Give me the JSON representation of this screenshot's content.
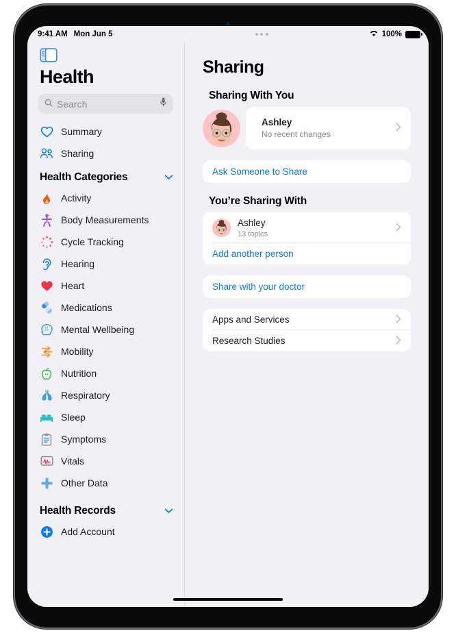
{
  "statusbar": {
    "time": "9:41 AM",
    "date": "Mon Jun 5",
    "battery_pct": "100%",
    "wifi_icon": "wifi-icon",
    "battery_icon": "battery-icon",
    "multitask_icon": "multitasking-dots-icon"
  },
  "sidebar": {
    "toggle_icon": "sidebar-toggle-icon",
    "title": "Health",
    "search": {
      "placeholder": "Search",
      "value": "",
      "search_icon": "search-icon",
      "mic_icon": "microphone-icon"
    },
    "primary": [
      {
        "label": "Summary",
        "icon": "heart-outline-icon"
      },
      {
        "label": "Sharing",
        "icon": "two-people-icon"
      }
    ],
    "categories_header": {
      "label": "Health Categories",
      "chevron": "chevron-down-icon"
    },
    "categories": [
      {
        "label": "Activity",
        "icon": "flame-icon"
      },
      {
        "label": "Body Measurements",
        "icon": "body-figure-icon"
      },
      {
        "label": "Cycle Tracking",
        "icon": "cycle-dots-icon"
      },
      {
        "label": "Hearing",
        "icon": "ear-icon"
      },
      {
        "label": "Heart",
        "icon": "heart-filled-icon"
      },
      {
        "label": "Medications",
        "icon": "pills-icon"
      },
      {
        "label": "Mental Wellbeing",
        "icon": "head-brain-icon"
      },
      {
        "label": "Mobility",
        "icon": "arrows-walk-icon"
      },
      {
        "label": "Nutrition",
        "icon": "apple-icon"
      },
      {
        "label": "Respiratory",
        "icon": "lungs-icon"
      },
      {
        "label": "Sleep",
        "icon": "bed-icon"
      },
      {
        "label": "Symptoms",
        "icon": "clipboard-icon"
      },
      {
        "label": "Vitals",
        "icon": "waveform-monitor-icon"
      },
      {
        "label": "Other Data",
        "icon": "plus-cross-icon"
      }
    ],
    "records_header": {
      "label": "Health Records",
      "chevron": "chevron-down-icon"
    },
    "records": [
      {
        "label": "Add Account",
        "icon": "plus-circle-icon"
      }
    ]
  },
  "main": {
    "title": "Sharing",
    "sharing_with_you": {
      "header": "Sharing With You",
      "person": {
        "name": "Ashley",
        "status": "No recent changes",
        "avatar": "memoji-avatar",
        "chevron": "chevron-right-icon"
      },
      "ask_label": "Ask Someone to Share"
    },
    "youre_sharing_with": {
      "header": "You’re Sharing With",
      "person": {
        "name": "Ashley",
        "detail": "13 topics",
        "avatar": "memoji-avatar",
        "chevron": "chevron-right-icon"
      },
      "add_label": "Add another person"
    },
    "doctor_label": "Share with your doctor",
    "extra_rows": [
      {
        "label": "Apps and Services",
        "chevron": "chevron-right-icon"
      },
      {
        "label": "Research Studies",
        "chevron": "chevron-right-icon"
      }
    ]
  },
  "colors": {
    "accent": "#047aff",
    "sidebar_bg": "#f1f0f5",
    "card_bg": "#ffffff"
  }
}
